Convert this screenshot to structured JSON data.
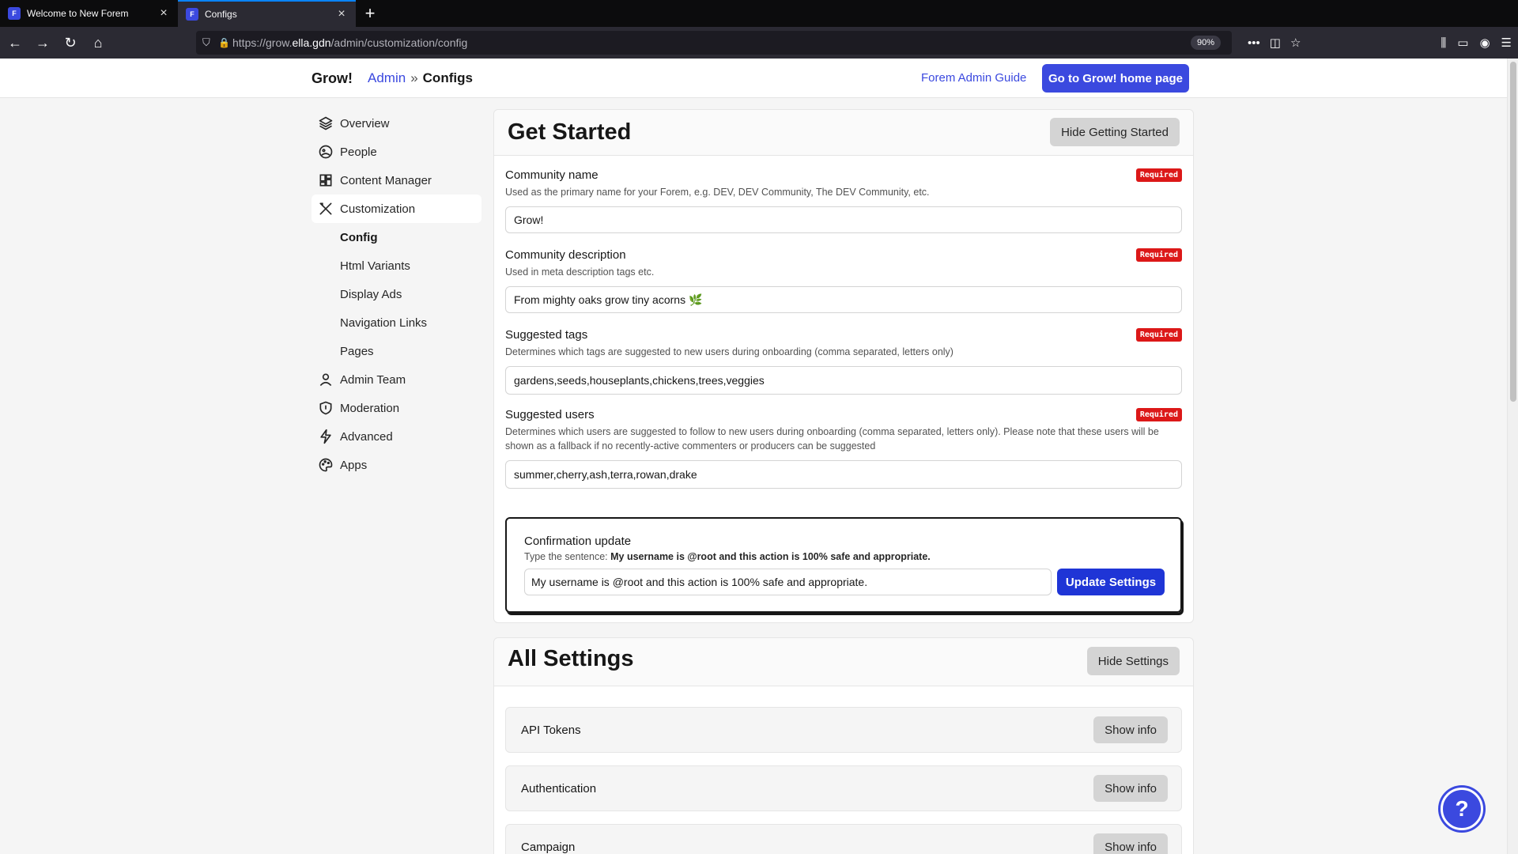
{
  "browser": {
    "tabs": [
      {
        "title": "Welcome to New Forem",
        "active": false
      },
      {
        "title": "Configs",
        "active": true
      }
    ],
    "url_prefix": "https://grow.",
    "url_domain": "ella.gdn",
    "url_path": "/admin/customization/config",
    "zoom": "90%"
  },
  "header": {
    "brand": "Grow!",
    "breadcrumb_link": "Admin",
    "breadcrumb_sep": "»",
    "breadcrumb_current": "Configs",
    "guide_link": "Forem Admin Guide",
    "home_button": "Go to Grow! home page"
  },
  "sidebar": {
    "items": [
      {
        "label": "Overview",
        "icon": "layers-icon"
      },
      {
        "label": "People",
        "icon": "globe-people-icon"
      },
      {
        "label": "Content Manager",
        "icon": "grid-icon"
      },
      {
        "label": "Customization",
        "icon": "tools-icon",
        "active": true
      }
    ],
    "sub_items": [
      {
        "label": "Config",
        "active": true
      },
      {
        "label": "Html Variants"
      },
      {
        "label": "Display Ads"
      },
      {
        "label": "Navigation Links"
      },
      {
        "label": "Pages"
      }
    ],
    "items_after": [
      {
        "label": "Admin Team",
        "icon": "user-icon"
      },
      {
        "label": "Moderation",
        "icon": "shield-icon"
      },
      {
        "label": "Advanced",
        "icon": "lightning-icon"
      },
      {
        "label": "Apps",
        "icon": "palette-icon"
      }
    ]
  },
  "get_started": {
    "title": "Get Started",
    "hide_button": "Hide Getting Started",
    "required_badge": "Required",
    "fields": [
      {
        "label": "Community name",
        "hint": "Used as the primary name for your Forem, e.g. DEV, DEV Community, The DEV Community, etc.",
        "value": "Grow!"
      },
      {
        "label": "Community description",
        "hint": "Used in meta description tags etc.",
        "value": "From mighty oaks grow tiny acorns 🌿"
      },
      {
        "label": "Suggested tags",
        "hint": "Determines which tags are suggested to new users during onboarding (comma separated, letters only)",
        "value": "gardens,seeds,houseplants,chickens,trees,veggies"
      },
      {
        "label": "Suggested users",
        "hint": "Determines which users are suggested to follow to new users during onboarding (comma separated, letters only). Please note that these users will be shown as a fallback if no recently-active commenters or producers can be suggested",
        "value": "summer,cherry,ash,terra,rowan,drake"
      }
    ],
    "confirm": {
      "title": "Confirmation update",
      "hint_prefix": "Type the sentence: ",
      "hint_sentence": "My username is @root and this action is 100% safe and appropriate.",
      "input_value": "My username is @root and this action is 100% safe and appropriate.",
      "button": "Update Settings"
    }
  },
  "all_settings": {
    "title": "All Settings",
    "hide_button": "Hide Settings",
    "show_label": "Show info",
    "rows": [
      "API Tokens",
      "Authentication",
      "Campaign"
    ]
  },
  "colors": {
    "accent": "#3b49df",
    "required": "#dc1818",
    "update_button": "#1f35d6"
  }
}
